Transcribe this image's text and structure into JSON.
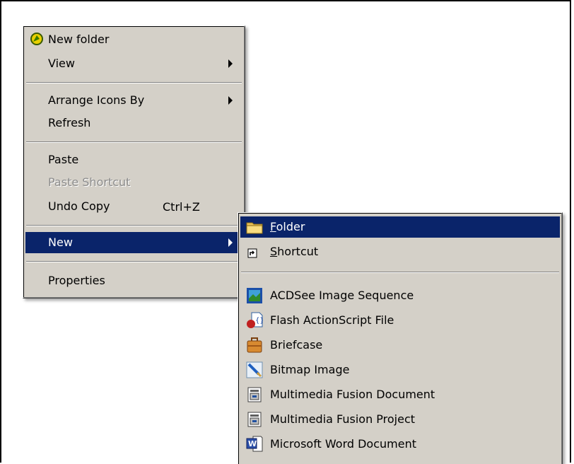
{
  "context_menu": {
    "items": [
      {
        "label": "New folder"
      },
      {
        "label": "View"
      },
      {
        "label": "Arrange Icons By"
      },
      {
        "label": "Refresh"
      },
      {
        "label": "Paste"
      },
      {
        "label": "Paste Shortcut"
      },
      {
        "label": "Undo Copy",
        "accelerator": "Ctrl+Z"
      },
      {
        "label": "New"
      },
      {
        "label": "Properties"
      }
    ]
  },
  "new_submenu": {
    "items": [
      {
        "label_rest": "older",
        "mnemonic": "F",
        "icon": "folder-icon"
      },
      {
        "label_rest": "hortcut",
        "mnemonic": "S",
        "icon": "shortcut-icon"
      },
      {
        "label": "ACDSee Image Sequence",
        "icon": "acdsee-icon"
      },
      {
        "label": "Flash ActionScript File",
        "icon": "flash-actionscript-icon"
      },
      {
        "label": "Briefcase",
        "icon": "briefcase-icon"
      },
      {
        "label": "Bitmap Image",
        "icon": "bitmap-icon"
      },
      {
        "label": "Multimedia Fusion Document",
        "icon": "mmf-document-icon"
      },
      {
        "label": "Multimedia Fusion Project",
        "icon": "mmf-project-icon"
      },
      {
        "label": "Microsoft Word Document",
        "icon": "word-document-icon"
      }
    ]
  },
  "colors": {
    "menu_bg": "#d4d0c8",
    "highlight": "#0a246a",
    "disabled_text": "#8c8c8c"
  }
}
